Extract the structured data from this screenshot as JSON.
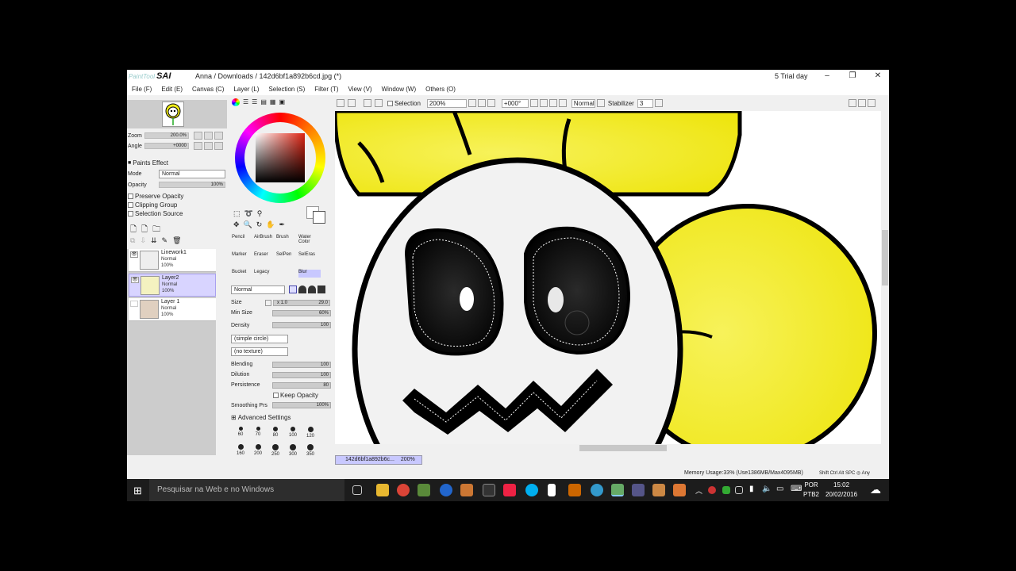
{
  "window": {
    "app_name_small": "PaintTool",
    "app_name": "SAI",
    "doc_title": "Anna / Downloads / 142d6bf1a892b6cd.jpg (*)",
    "trial": "5 Trial day"
  },
  "menu": [
    {
      "label": "File (F)"
    },
    {
      "label": "Edit (E)"
    },
    {
      "label": "Canvas (C)"
    },
    {
      "label": "Layer (L)"
    },
    {
      "label": "Selection (S)"
    },
    {
      "label": "Filter (T)"
    },
    {
      "label": "View (V)"
    },
    {
      "label": "Window (W)"
    },
    {
      "label": "Others (O)"
    }
  ],
  "navigator": {
    "zoom_label": "Zoom",
    "zoom_value": "200.0%",
    "angle_label": "Angle",
    "angle_value": "+0000"
  },
  "layer_props": {
    "paints_effect": "Paints Effect",
    "mode_label": "Mode",
    "mode_value": "Normal",
    "opacity_label": "Opacity",
    "opacity_value": "100%",
    "preserve_opacity": "Preserve Opacity",
    "clipping_group": "Clipping Group",
    "selection_source": "Selection Source"
  },
  "layers": [
    {
      "name": "Linework1",
      "mode": "Normal",
      "opacity": "100%"
    },
    {
      "name": "Layer2",
      "mode": "Normal",
      "opacity": "100%"
    },
    {
      "name": "Layer 1",
      "mode": "Normal",
      "opacity": "100%"
    }
  ],
  "tools": {
    "row1": [
      "Pencil",
      "AirBrush",
      "Brush",
      "Water Color"
    ],
    "row2": [
      "Marker",
      "Eraser",
      "SelPen",
      "SelEras"
    ],
    "row3": [
      "Bucket",
      "Legacy",
      "",
      "Blur"
    ]
  },
  "brush": {
    "blend_mode": "Normal",
    "size_label": "Size",
    "size_mult": "x 1.0",
    "size_value": "29.0",
    "minsize_label": "Min Size",
    "minsize_value": "60%",
    "density_label": "Density",
    "density_value": "100",
    "shape": "(simple circle)",
    "texture": "(no texture)",
    "blending_label": "Blending",
    "blending_value": "100",
    "dilution_label": "Dilution",
    "dilution_value": "100",
    "persistence_label": "Persistence",
    "persistence_value": "80",
    "keep_opacity": "Keep Opacity",
    "smoothing_label": "Smoothing Prs",
    "smoothing_value": "100%",
    "advanced": "Advanced Settings",
    "sizes_row1": [
      "60",
      "70",
      "80",
      "100",
      "120"
    ],
    "sizes_row2": [
      "160",
      "200",
      "250",
      "300",
      "350"
    ]
  },
  "canvas_toolbar": {
    "selection_label": "Selection",
    "zoom": "200%",
    "angle": "+000°",
    "mode": "Normal",
    "stabilizer_label": "Stabilizer",
    "stabilizer_value": "3"
  },
  "canvas_tab": {
    "name": "142d6bf1a892b6c...",
    "zoom": "200%"
  },
  "status": {
    "memory": "Memory Usage:33% (Use1386MB/Max4095MB)",
    "keys": "Shift Ctrl Alt SPC ◎ Any"
  },
  "taskbar": {
    "search_placeholder": "Pesquisar na Web e no Windows",
    "lang1": "POR",
    "lang2": "PTB2",
    "time": "15:02",
    "date": "20/02/2016"
  },
  "colors": {
    "yellow": "#f2ee18",
    "selection_bg": "#d8d4ff",
    "taskbar": "#1c1c1c"
  }
}
